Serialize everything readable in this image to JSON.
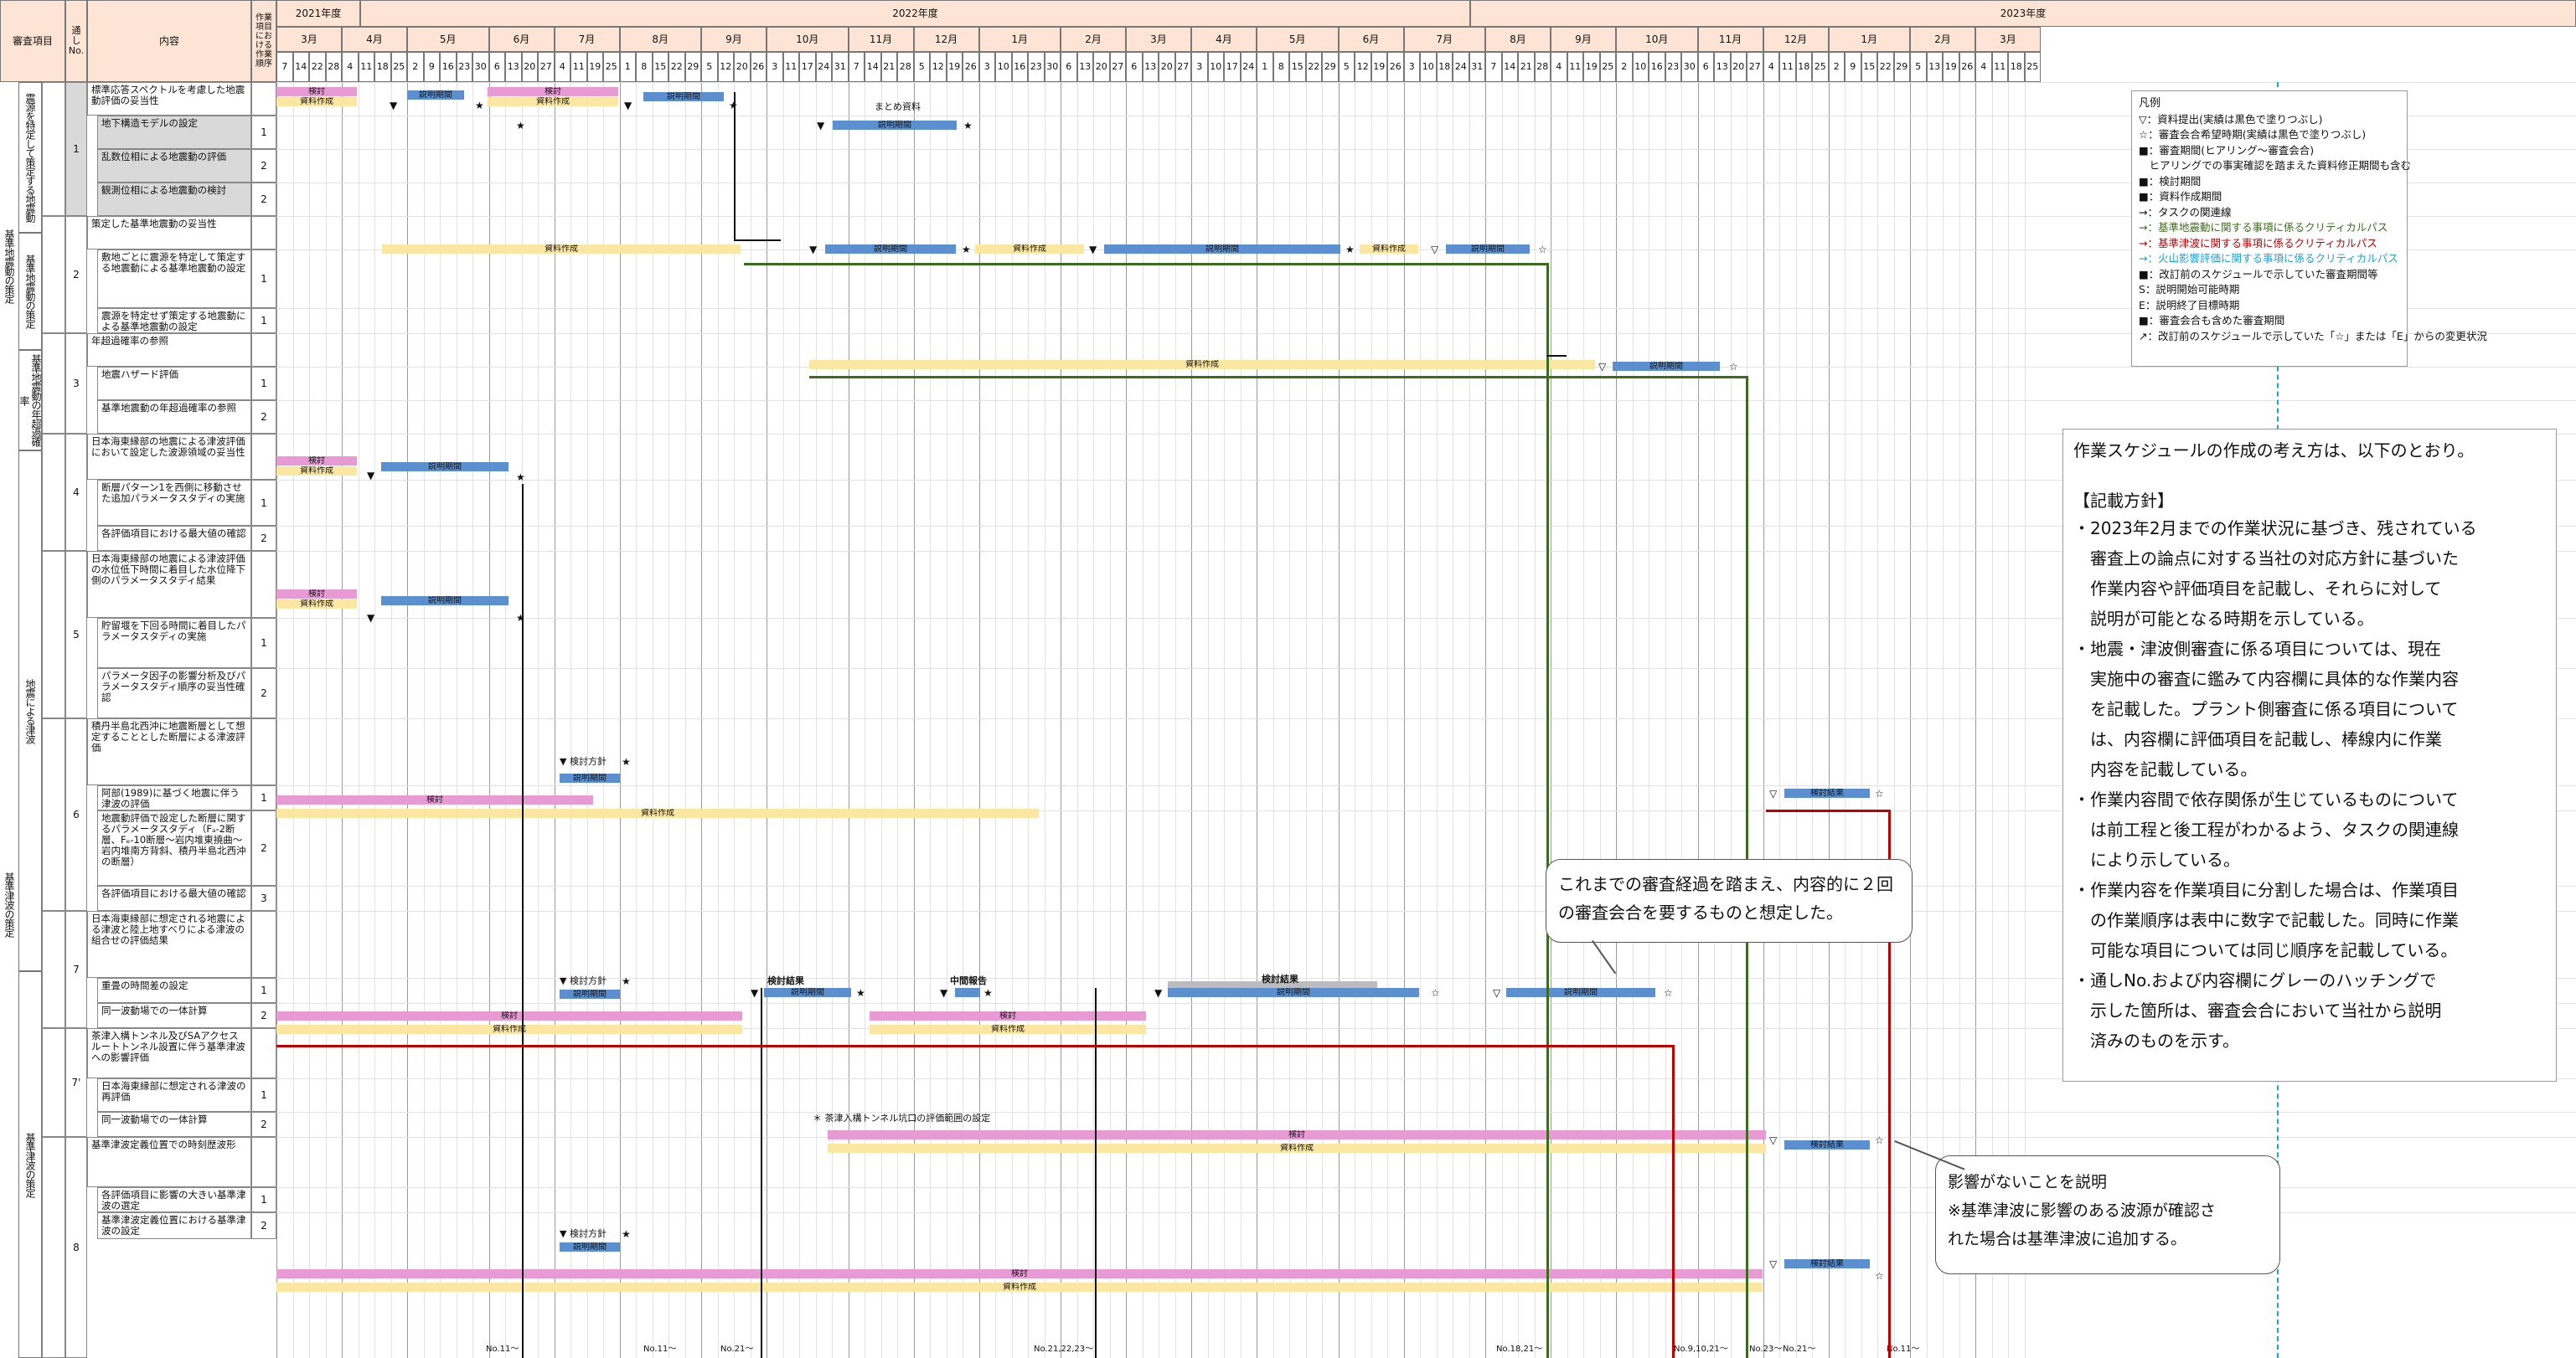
{
  "header": {
    "col_shinsa": "審査項目",
    "col_toshi": "通しNo.",
    "col_naiyo": "内容",
    "col_order": "作業項目における作業順序",
    "fy2021": "2021年度",
    "fy2022": "2022年度",
    "fy2023": "2023年度",
    "months": [
      "3月",
      "4月",
      "5月",
      "6月",
      "7月",
      "8月",
      "9月",
      "10月",
      "11月",
      "12月",
      "1月",
      "2月",
      "3月",
      "4月",
      "5月",
      "6月",
      "7月",
      "8月",
      "9月",
      "10月",
      "11月",
      "12月",
      "1月",
      "2月",
      "3月"
    ],
    "days": [
      [
        "7",
        "14",
        "22",
        "28"
      ],
      [
        "4",
        "11",
        "18",
        "25"
      ],
      [
        "2",
        "9",
        "16",
        "23",
        "30"
      ],
      [
        "6",
        "13",
        "20",
        "27"
      ],
      [
        "4",
        "11",
        "19",
        "25"
      ],
      [
        "1",
        "8",
        "15",
        "22",
        "29"
      ],
      [
        "5",
        "12",
        "20",
        "26"
      ],
      [
        "3",
        "11",
        "17",
        "24",
        "31"
      ],
      [
        "7",
        "14",
        "21",
        "28"
      ],
      [
        "5",
        "12",
        "19",
        "26"
      ],
      [
        "3",
        "10",
        "16",
        "23",
        "30"
      ],
      [
        "6",
        "13",
        "20",
        "27"
      ],
      [
        "6",
        "13",
        "20",
        "27"
      ],
      [
        "3",
        "10",
        "17",
        "24"
      ],
      [
        "1",
        "8",
        "15",
        "22",
        "29"
      ],
      [
        "5",
        "12",
        "19",
        "26"
      ],
      [
        "3",
        "10",
        "18",
        "24",
        "31"
      ],
      [
        "7",
        "14",
        "21",
        "28"
      ],
      [
        "4",
        "11",
        "19",
        "25"
      ],
      [
        "2",
        "10",
        "16",
        "23",
        "30"
      ],
      [
        "6",
        "13",
        "20",
        "27"
      ],
      [
        "4",
        "11",
        "18",
        "25"
      ],
      [
        "2",
        "9",
        "15",
        "22",
        "29"
      ],
      [
        "5",
        "13",
        "19",
        "26"
      ],
      [
        "4",
        "11",
        "18",
        "25"
      ]
    ]
  },
  "left": {
    "groups": [
      {
        "label": "基準地震動の策定"
      },
      {
        "label": "基準津波の策定"
      }
    ],
    "subgroups": [
      {
        "label": "震源を特定して策定する地震動"
      },
      {
        "label": "基準地震動の策定"
      },
      {
        "label": "基準地震動の年超過確率"
      },
      {
        "label": "地震による津波"
      },
      {
        "label": "基準津波の策定"
      }
    ],
    "rows": [
      {
        "no": "1",
        "text": "標準応答スペクトルを考慮した地震動評価の妥当性",
        "order": "",
        "gray": false
      },
      {
        "no": "",
        "text": "地下構造モデルの設定",
        "order": "1",
        "gray": true
      },
      {
        "no": "",
        "text": "乱数位相による地震動の評価",
        "order": "2",
        "gray": true
      },
      {
        "no": "",
        "text": "観測位相による地震動の検討",
        "order": "2",
        "gray": true
      },
      {
        "no": "2",
        "text": "策定した基準地震動の妥当性",
        "order": "",
        "gray": false
      },
      {
        "no": "",
        "text": "敷地ごとに震源を特定して策定する地震動による基準地震動の設定",
        "order": "1",
        "gray": false
      },
      {
        "no": "",
        "text": "震源を特定せず策定する地震動による基準地震動の設定",
        "order": "1",
        "gray": false
      },
      {
        "no": "3",
        "text": "年超過確率の参照",
        "order": "",
        "gray": false
      },
      {
        "no": "",
        "text": "地震ハザード評価",
        "order": "1",
        "gray": false
      },
      {
        "no": "",
        "text": "基準地震動の年超過確率の参照",
        "order": "2",
        "gray": false
      },
      {
        "no": "4",
        "text": "日本海東縁部の地震による津波評価において設定した波源領域の妥当性",
        "order": "",
        "gray": false
      },
      {
        "no": "",
        "text": "断層パターン1を西側に移動させた追加パラメータスタディの実施",
        "order": "1",
        "gray": false
      },
      {
        "no": "",
        "text": "各評価項目における最大値の確認",
        "order": "2",
        "gray": false
      },
      {
        "no": "5",
        "text": "日本海東縁部の地震による津波評価の水位低下時間に着目した水位降下側のパラメータスタディ結果",
        "order": "",
        "gray": false
      },
      {
        "no": "",
        "text": "貯留堰を下回る時間に着目したパラメータスタディの実施",
        "order": "1",
        "gray": false
      },
      {
        "no": "",
        "text": "パラメータ因子の影響分析及びパラメータスタディ順序の妥当性確認",
        "order": "2",
        "gray": false
      },
      {
        "no": "6",
        "text": "積丹半島北西沖に地震断層として想定することとした断層による津波評価",
        "order": "",
        "gray": false
      },
      {
        "no": "",
        "text": "阿部(1989)に基づく地震に伴う津波の評価",
        "order": "1",
        "gray": false
      },
      {
        "no": "",
        "text": "地震動評価で設定した断層に関するパラメータスタディ（Fₐ-2断層、Fₑ-10断層〜岩内堆東撓曲〜岩内堆南方背斜、積丹半島北西沖の断層）",
        "order": "2",
        "gray": false
      },
      {
        "no": "",
        "text": "各評価項目における最大値の確認",
        "order": "3",
        "gray": false
      },
      {
        "no": "7",
        "text": "日本海東縁部に想定される地震による津波と陸上地すべりによる津波の組合せの評価結果",
        "order": "",
        "gray": false
      },
      {
        "no": "",
        "text": "重畳の時間差の設定",
        "order": "1",
        "gray": false
      },
      {
        "no": "",
        "text": "同一波動場での一体計算",
        "order": "2",
        "gray": false
      },
      {
        "no": "7'",
        "text": "茶津入構トンネル及びSAアクセスルートトンネル設置に伴う基準津波への影響評価",
        "order": "",
        "gray": false
      },
      {
        "no": "",
        "text": "日本海東縁部に想定される津波の再評価",
        "order": "1",
        "gray": false
      },
      {
        "no": "",
        "text": "同一波動場での一体計算",
        "order": "2",
        "gray": false
      },
      {
        "no": "8",
        "text": "基準津波定義位置での時刻歴波形",
        "order": "",
        "gray": false
      },
      {
        "no": "",
        "text": "各評価項目に影響の大きい基準津波の選定",
        "order": "1",
        "gray": false
      },
      {
        "no": "",
        "text": "基準津波定義位置における基準津波の設定",
        "order": "2",
        "gray": false
      }
    ]
  },
  "bars": {
    "kento": "検討",
    "shiryo": "資料作成",
    "setsumei": "説明期間",
    "matome": "まとめ資料",
    "kento_hoshin": "検討方針",
    "kento_kekka": "検討結果",
    "chukan": "中間報告",
    "chatsu_note": "茶津入構トンネル坑口の評価範囲の設定"
  },
  "bottom_notes": [
    "No.11〜",
    "No.11〜",
    "No.21〜",
    "No.21,22,23〜",
    "No.18,21〜",
    "No.9,10,21〜",
    "No.23〜",
    "No.21〜",
    "No.11〜"
  ],
  "legend": {
    "title": "凡例",
    "items": [
      "▽：資料提出(実績は黒色で塗りつぶし)",
      "☆：審査会合希望時期(実績は黒色で塗りつぶし)",
      "■：審査期間(ヒアリング〜審査会合)",
      "　ヒアリングでの事実確認を踏まえた資料修正期間も含む",
      "■：検討期間",
      "■：資料作成期間",
      "→：タスクの関連線",
      "→：基準地震動に関する事項に係るクリティカルパス",
      "→：基準津波に関する事項に係るクリティカルパス",
      "→：火山影響評価に関する事項に係るクリティカルパス",
      "■：改訂前のスケジュールで示していた審査期間等",
      "S：説明開始可能時期",
      "E：説明終了目標時期",
      "■：審査会合も含めた審査期間",
      "↗：改訂前のスケジュールで示していた「☆」または「E」からの変更状況"
    ],
    "colors": [
      "#111111",
      "#111111",
      "#5b8fcf",
      "#ffffff",
      "#e79ad3",
      "#fbe6a2",
      "#111111",
      "#3d6b1e",
      "#c00000",
      "#1ea0d8",
      "#bcbcbc",
      "#111111",
      "#111111",
      "#8cc63f",
      "#555555"
    ]
  },
  "policy": {
    "intro": "作業スケジュールの作成の考え方は、以下のとおり。",
    "heading": "【記載方針】",
    "lines": [
      "・2023年2月までの作業状況に基づき、残されている",
      "　審査上の論点に対する当社の対応方針に基づいた",
      "　作業内容や評価項目を記載し、それらに対して",
      "　説明が可能となる時期を示している。",
      "・地震・津波側審査に係る項目については、現在",
      "　実施中の審査に鑑みて内容欄に具体的な作業内容",
      "　を記載した。プラント側審査に係る項目について",
      "　は、内容欄に評価項目を記載し、棒線内に作業",
      "　内容を記載している。",
      "・作業内容間で依存関係が生じているものについて",
      "　は前工程と後工程がわかるよう、タスクの関連線",
      "　により示している。",
      "・作業内容を作業項目に分割した場合は、作業項目",
      "　の作業順序は表中に数字で記載した。同時に作業",
      "　可能な項目については同じ順序を記載している。",
      "・通しNo.および内容欄にグレーのハッチングで",
      "　示した箇所は、審査会合において当社から説明",
      "　済みのものを示す。"
    ]
  },
  "callouts": {
    "c1": "これまでの審査経過を踏まえ、内容的に２回の審査会合を要するものと想定した。",
    "c2_line1": "影響がないことを説明",
    "c2_line2": "※基準津波に影響のある波源が確認さ",
    "c2_line3": "れた場合は基準津波に追加する。"
  }
}
